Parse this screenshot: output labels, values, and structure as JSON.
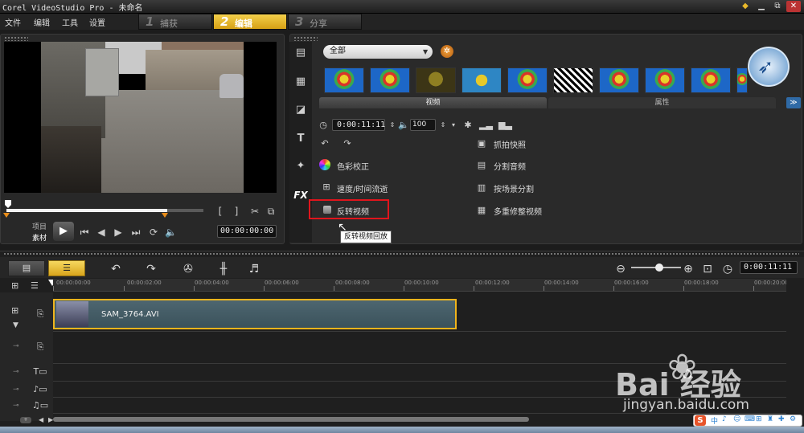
{
  "window": {
    "title": "Corel VideoStudio Pro - 未命名",
    "minimize": "▁",
    "restore": "⧉",
    "close": "✕",
    "logo": "◆"
  },
  "menu": [
    "文件",
    "编辑",
    "工具",
    "设置"
  ],
  "steps": [
    {
      "num": "1",
      "label": "捕获"
    },
    {
      "num": "2",
      "label": "编辑"
    },
    {
      "num": "3",
      "label": "分享"
    }
  ],
  "preview": {
    "mode_project": "项目",
    "mode_clip": "素材",
    "timecode": "00:00:00:00",
    "mark_in": "[",
    "mark_out": "]"
  },
  "library": {
    "filter": "全部",
    "tabs": {
      "video": "视频",
      "attributes": "属性"
    },
    "thumbnails": [
      "balloon",
      "balloon",
      "balloon",
      "balloon",
      "balloon",
      "balloon",
      "balloon",
      "balloon",
      "balloon",
      "balloon",
      "balloon",
      "balloon"
    ],
    "duration": "0:00:11:11",
    "volume": "100",
    "options": [
      {
        "label": "抓拍快照",
        "icon": "camera-icon"
      },
      {
        "label": "色彩校正",
        "icon": "color-wheel-icon"
      },
      {
        "label": "分割音频",
        "icon": "split-audio-icon"
      },
      {
        "label": "速度/时间流逝",
        "icon": "speed-icon"
      },
      {
        "label": "按场景分割",
        "icon": "scene-split-icon"
      },
      {
        "label": "反转视频",
        "icon": "checkbox-icon"
      },
      {
        "label": "多重修整视频",
        "icon": "multi-trim-icon"
      }
    ],
    "tooltip": "反转视频回放"
  },
  "timeline": {
    "timecode": "0:00:11:11",
    "ruler_labels": [
      "00:00:00:00",
      "00:00:02:00",
      "00:00:04:00",
      "00:00:06:00",
      "00:00:08:00",
      "00:00:10:00",
      "00:00:12:00",
      "00:00:14:00",
      "00:00:16:00",
      "00:00:18:00",
      "00:00:20:00"
    ],
    "clip_name": "SAM_3764.AVI"
  },
  "watermark": {
    "text": "Bai  经验",
    "url": "jingyan.baidu.com"
  },
  "ime": {
    "logo": "S",
    "items": [
      "中",
      "♪",
      "☺",
      "⌨",
      "⊞",
      "♜",
      "✚",
      "⚙"
    ]
  },
  "colors": {
    "accent": "#E9B82A",
    "highlight": "#E0151C",
    "clip_border": "#F0B41C"
  }
}
